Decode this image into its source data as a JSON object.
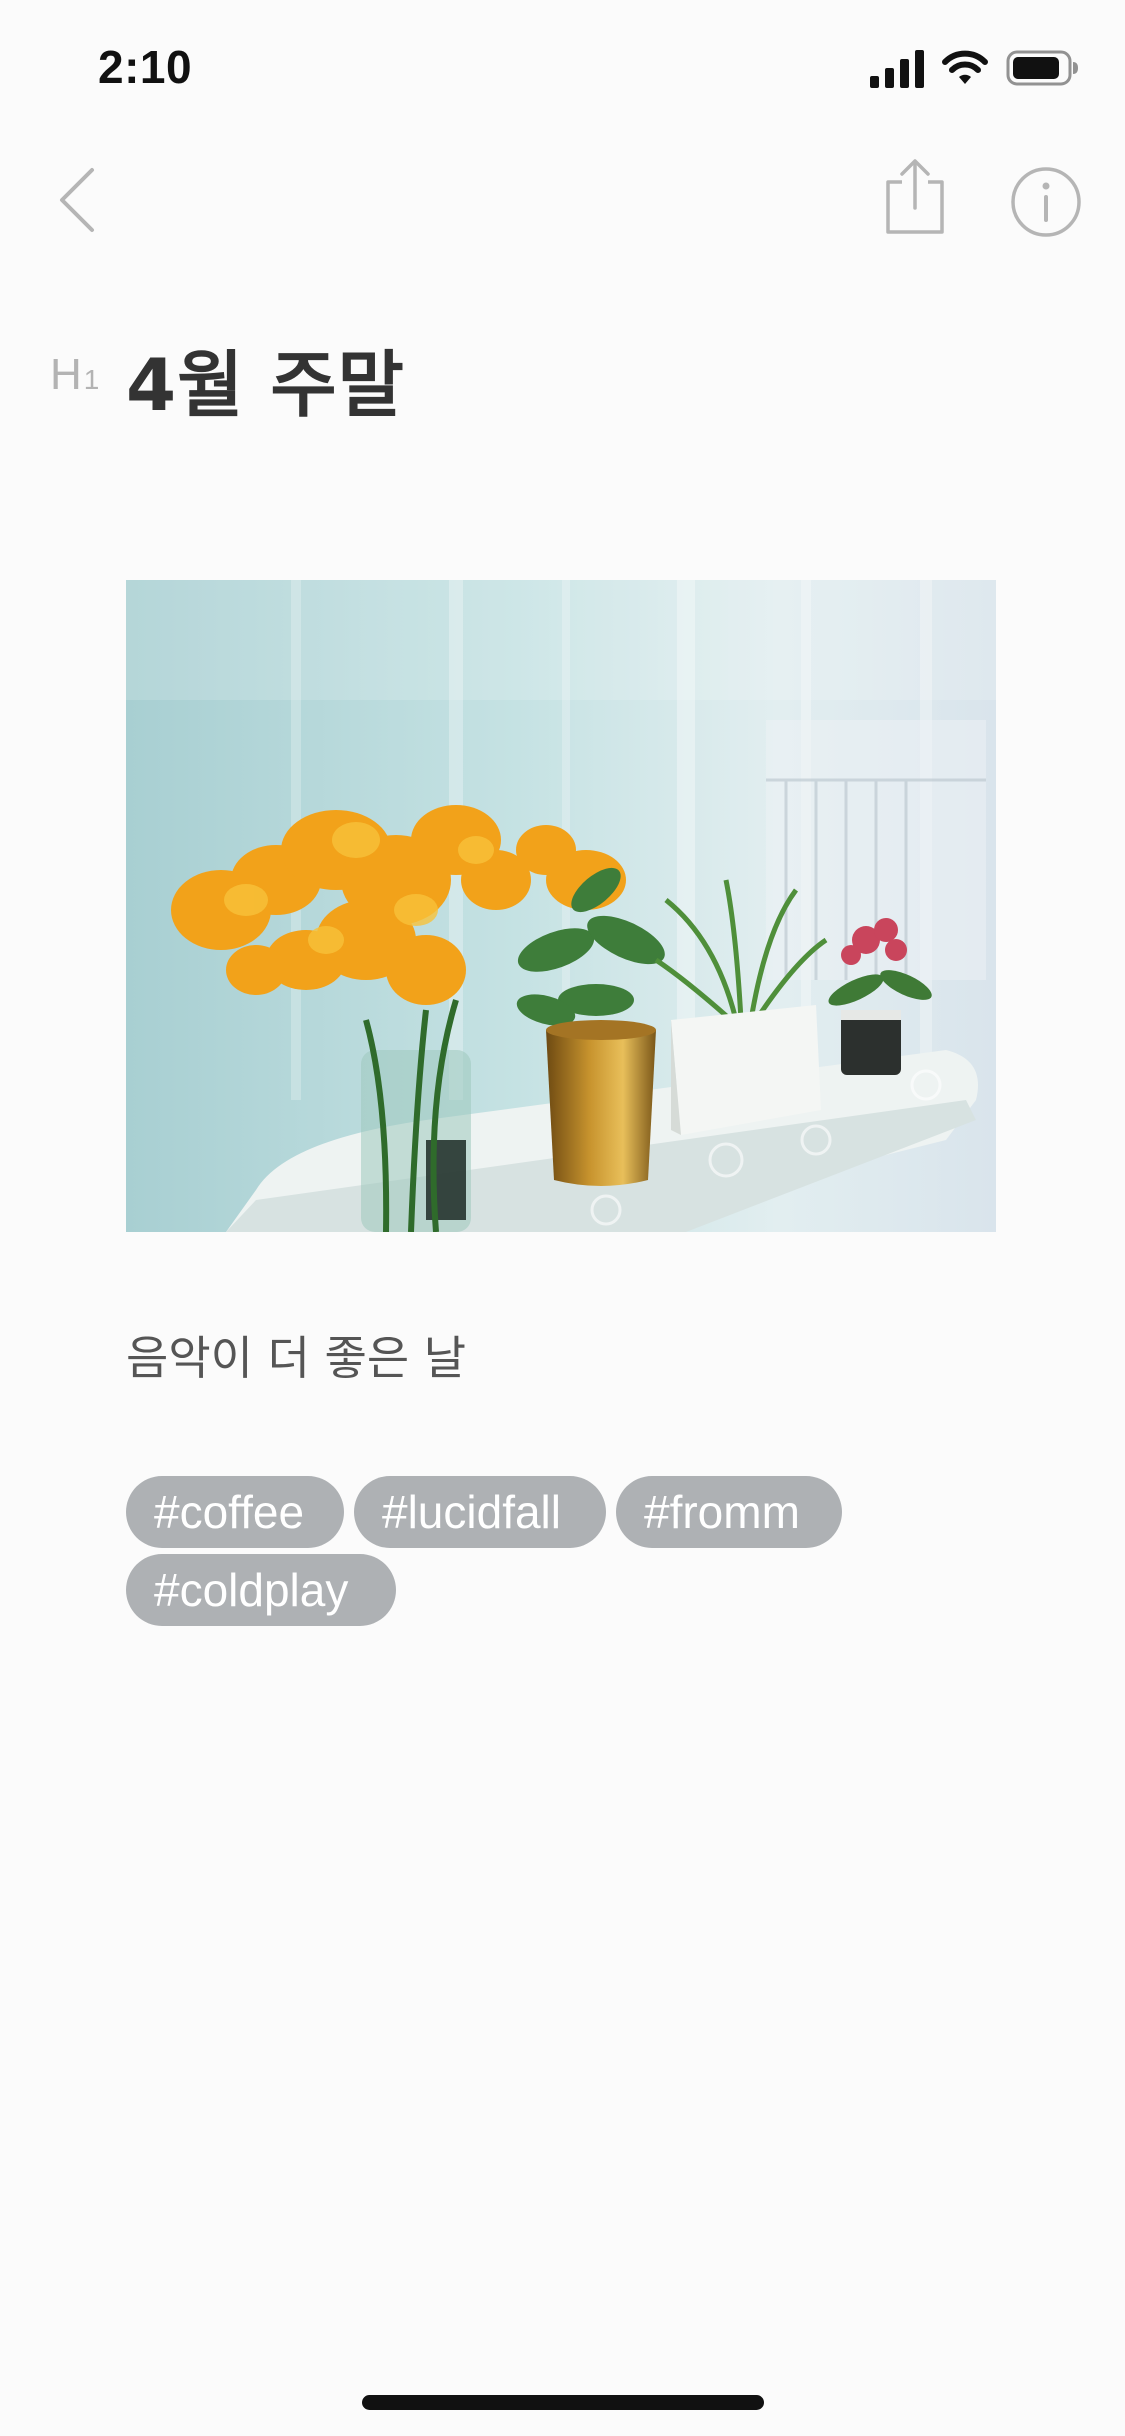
{
  "status_bar": {
    "time": "2:10",
    "icons": [
      "cellular-signal-icon",
      "wifi-icon",
      "battery-icon"
    ]
  },
  "nav": {
    "back_icon": "chevron-left-icon",
    "share_icon": "share-icon",
    "info_icon": "info-icon"
  },
  "note": {
    "heading_marker": "H",
    "heading_marker_sub": "1",
    "title": "4월 주말",
    "body": "음악이 더 좋은 날",
    "tags": [
      "#coffee",
      "#lucidfall",
      "#fromm",
      "#coldplay"
    ]
  },
  "colors": {
    "background": "#fbfbfb",
    "tag_bg": "#aeb1b4",
    "icon_gray": "#b5b5b5",
    "title": "#333333"
  }
}
